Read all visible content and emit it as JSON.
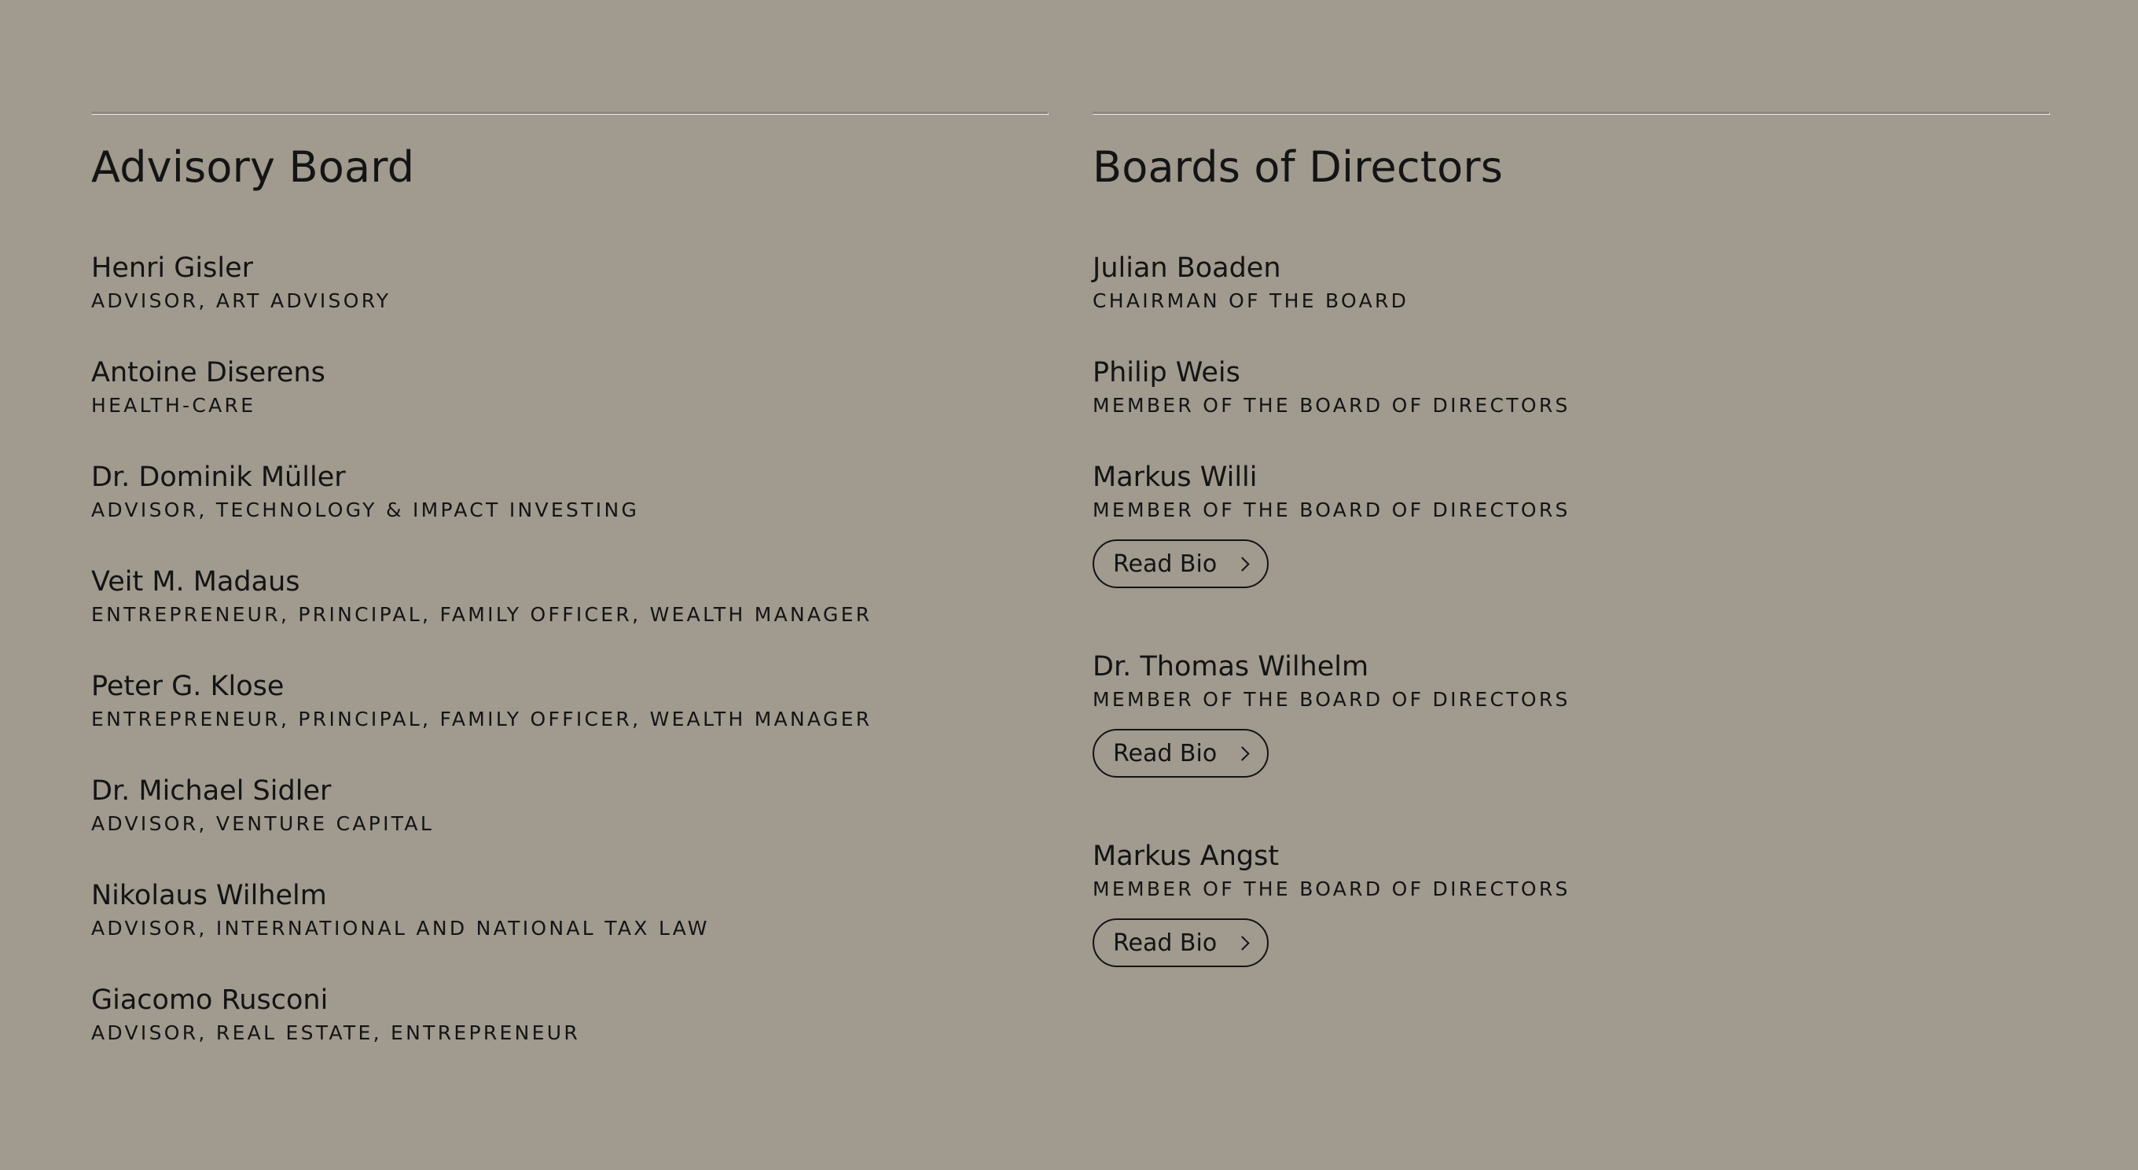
{
  "advisory": {
    "title": "Advisory Board",
    "members": [
      {
        "name": "Henri Gisler",
        "role": "ADVISOR, ART ADVISORY"
      },
      {
        "name": "Antoine Diserens",
        "role": "HEALTH-CARE"
      },
      {
        "name": "Dr. Dominik Müller",
        "role": "ADVISOR, TECHNOLOGY & IMPACT INVESTING"
      },
      {
        "name": "Veit M. Madaus",
        "role": "ENTREPRENEUR, PRINCIPAL, FAMILY OFFICER, WEALTH MANAGER"
      },
      {
        "name": "Peter G. Klose",
        "role": "ENTREPRENEUR, PRINCIPAL, FAMILY OFFICER, WEALTH MANAGER"
      },
      {
        "name": "Dr. Michael Sidler",
        "role": "ADVISOR, VENTURE CAPITAL"
      },
      {
        "name": "Nikolaus Wilhelm",
        "role": "ADVISOR, INTERNATIONAL AND NATIONAL TAX LAW"
      },
      {
        "name": "Giacomo Rusconi",
        "role": "ADVISOR, REAL ESTATE, ENTREPRENEUR"
      }
    ]
  },
  "directors": {
    "title": "Boards of Directors",
    "read_bio_label": "Read Bio",
    "members": [
      {
        "name": "Julian Boaden",
        "role": "CHAIRMAN OF THE BOARD"
      },
      {
        "name": "Philip Weis",
        "role": "MEMBER OF THE BOARD OF DIRECTORS"
      },
      {
        "name": "Markus Willi",
        "role": "MEMBER OF THE BOARD OF DIRECTORS"
      },
      {
        "name": "Dr. Thomas Wilhelm",
        "role": "MEMBER OF THE BOARD OF DIRECTORS"
      },
      {
        "name": "Markus Angst",
        "role": "MEMBER OF THE BOARD OF DIRECTORS"
      }
    ]
  },
  "colors": {
    "background": "#a09a8f",
    "text": "#141414",
    "divider": "#8c867d"
  },
  "icons": {
    "bio_button": "chevron-right-icon"
  }
}
